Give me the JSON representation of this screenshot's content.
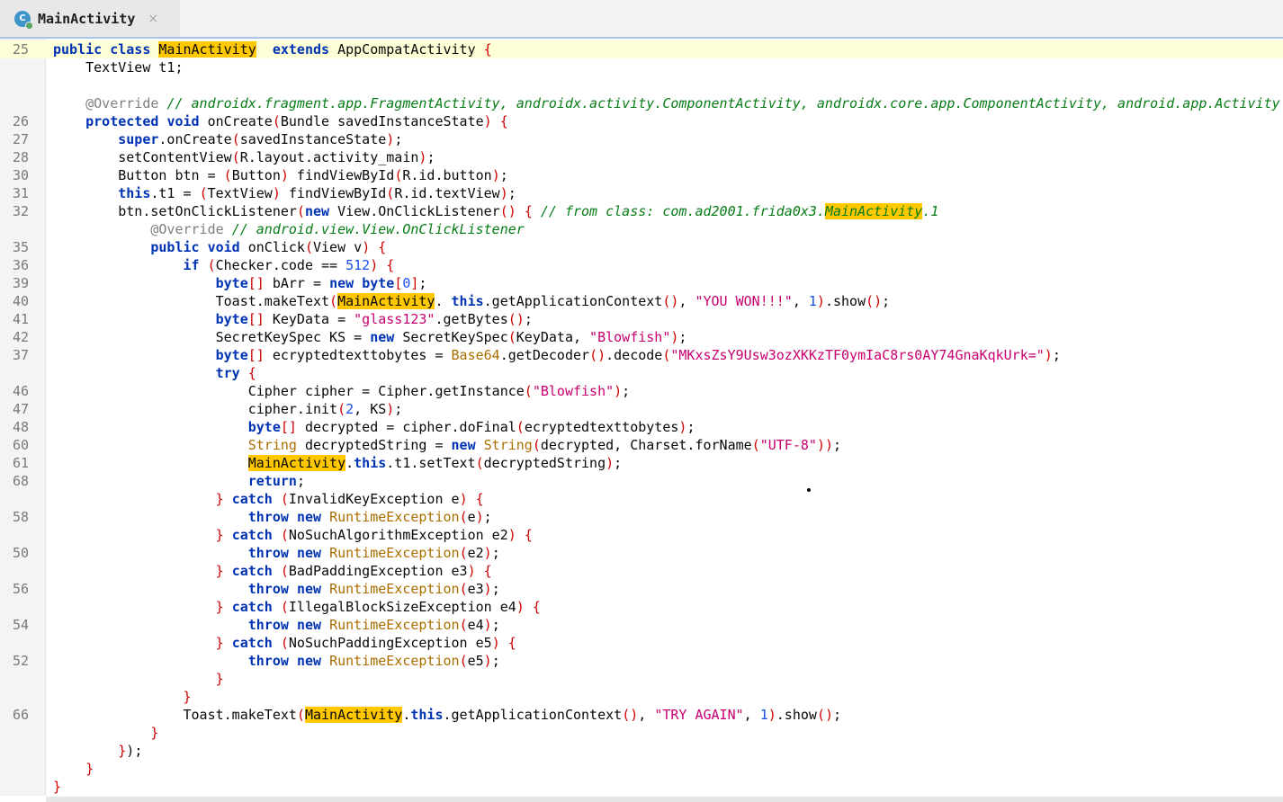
{
  "tab": {
    "title": "MainActivity",
    "icon": "class-icon",
    "icon_letter": "C",
    "close_glyph": "×"
  },
  "code_lines": [
    {
      "ln": "25",
      "hl": true,
      "segs": [
        [
          "k",
          "public "
        ],
        [
          "k",
          "class "
        ],
        [
          "h",
          "MainActivity"
        ],
        [
          "",
          "  "
        ],
        [
          "k",
          "extends "
        ],
        [
          "",
          "AppCompatActivity "
        ],
        [
          "b",
          "{"
        ]
      ]
    },
    {
      "ln": "",
      "segs": [
        [
          "",
          "    TextView t1;"
        ]
      ]
    },
    {
      "ln": "",
      "segs": []
    },
    {
      "ln": "",
      "segs": [
        [
          "",
          "    "
        ],
        [
          "a",
          "@Override "
        ],
        [
          "c",
          "// androidx.fragment.app.FragmentActivity, androidx.activity.ComponentActivity, androidx.core.app.ComponentActivity, android.app.Activity"
        ]
      ]
    },
    {
      "ln": "26",
      "segs": [
        [
          "",
          "    "
        ],
        [
          "k",
          "protected "
        ],
        [
          "k",
          "void "
        ],
        [
          "",
          "onCreate"
        ],
        [
          "b",
          "("
        ],
        [
          "",
          "Bundle savedInstanceState"
        ],
        [
          "b",
          ")"
        ],
        [
          "",
          " "
        ],
        [
          "b",
          "{"
        ]
      ]
    },
    {
      "ln": "27",
      "segs": [
        [
          "",
          "        "
        ],
        [
          "k",
          "super"
        ],
        [
          "",
          ".onCreate"
        ],
        [
          "b",
          "("
        ],
        [
          "",
          "savedInstanceState"
        ],
        [
          "b",
          ")"
        ],
        [
          "",
          ";"
        ]
      ]
    },
    {
      "ln": "28",
      "segs": [
        [
          "",
          "        setContentView"
        ],
        [
          "b",
          "("
        ],
        [
          "",
          "R.layout.activity_main"
        ],
        [
          "b",
          ")"
        ],
        [
          "",
          ";"
        ]
      ]
    },
    {
      "ln": "30",
      "segs": [
        [
          "",
          "        Button btn = "
        ],
        [
          "b",
          "("
        ],
        [
          "",
          "Button"
        ],
        [
          "b",
          ")"
        ],
        [
          "",
          " findViewById"
        ],
        [
          "b",
          "("
        ],
        [
          "",
          "R.id.button"
        ],
        [
          "b",
          ")"
        ],
        [
          "",
          ";"
        ]
      ]
    },
    {
      "ln": "31",
      "segs": [
        [
          "",
          "        "
        ],
        [
          "k",
          "this"
        ],
        [
          "",
          ".t1 = "
        ],
        [
          "b",
          "("
        ],
        [
          "",
          "TextView"
        ],
        [
          "b",
          ")"
        ],
        [
          "",
          " findViewById"
        ],
        [
          "b",
          "("
        ],
        [
          "",
          "R.id.textView"
        ],
        [
          "b",
          ")"
        ],
        [
          "",
          ";"
        ]
      ]
    },
    {
      "ln": "32",
      "segs": [
        [
          "",
          "        btn.setOnClickListener"
        ],
        [
          "b",
          "("
        ],
        [
          "k",
          "new "
        ],
        [
          "",
          "View.OnClickListener"
        ],
        [
          "b",
          "()"
        ],
        [
          "",
          " "
        ],
        [
          "b",
          "{"
        ],
        [
          "",
          " "
        ],
        [
          "c",
          "// from class: com.ad2001.frida0x3."
        ],
        [
          "ch",
          "MainActivity"
        ],
        [
          "c",
          ".1"
        ]
      ]
    },
    {
      "ln": "",
      "segs": [
        [
          "",
          "            "
        ],
        [
          "a",
          "@Override "
        ],
        [
          "c",
          "// android.view.View.OnClickListener"
        ]
      ]
    },
    {
      "ln": "35",
      "segs": [
        [
          "",
          "            "
        ],
        [
          "k",
          "public "
        ],
        [
          "k",
          "void "
        ],
        [
          "",
          "onClick"
        ],
        [
          "b",
          "("
        ],
        [
          "",
          "View v"
        ],
        [
          "b",
          ")"
        ],
        [
          "",
          " "
        ],
        [
          "b",
          "{"
        ]
      ]
    },
    {
      "ln": "36",
      "segs": [
        [
          "",
          "                "
        ],
        [
          "k",
          "if "
        ],
        [
          "b",
          "("
        ],
        [
          "",
          "Checker.code == "
        ],
        [
          "n",
          "512"
        ],
        [
          "b",
          ")"
        ],
        [
          "",
          " "
        ],
        [
          "b",
          "{"
        ]
      ]
    },
    {
      "ln": "39",
      "segs": [
        [
          "",
          "                    "
        ],
        [
          "k",
          "byte"
        ],
        [
          "b",
          "[]"
        ],
        [
          "",
          " bArr = "
        ],
        [
          "k",
          "new "
        ],
        [
          "k",
          "byte"
        ],
        [
          "b",
          "["
        ],
        [
          "n",
          "0"
        ],
        [
          "b",
          "]"
        ],
        [
          "",
          ";"
        ]
      ]
    },
    {
      "ln": "40",
      "segs": [
        [
          "",
          "                    Toast.makeText"
        ],
        [
          "b",
          "("
        ],
        [
          "h",
          "MainActivity"
        ],
        [
          "",
          ". "
        ],
        [
          "k",
          "this"
        ],
        [
          "",
          ".getApplicationContext"
        ],
        [
          "b",
          "()"
        ],
        [
          "",
          ", "
        ],
        [
          "s",
          "\"YOU WON!!!\""
        ],
        [
          "",
          ", "
        ],
        [
          "n",
          "1"
        ],
        [
          "b",
          ")"
        ],
        [
          "",
          ".show"
        ],
        [
          "b",
          "()"
        ],
        [
          "",
          ";"
        ]
      ]
    },
    {
      "ln": "41",
      "segs": [
        [
          "",
          "                    "
        ],
        [
          "k",
          "byte"
        ],
        [
          "b",
          "[]"
        ],
        [
          "",
          " KeyData = "
        ],
        [
          "s",
          "\"glass123\""
        ],
        [
          "",
          ".getBytes"
        ],
        [
          "b",
          "()"
        ],
        [
          "",
          ";"
        ]
      ]
    },
    {
      "ln": "42",
      "segs": [
        [
          "",
          "                    SecretKeySpec KS = "
        ],
        [
          "k",
          "new "
        ],
        [
          "",
          "SecretKeySpec"
        ],
        [
          "b",
          "("
        ],
        [
          "",
          "KeyData, "
        ],
        [
          "s",
          "\"Blowfish\""
        ],
        [
          "b",
          ")"
        ],
        [
          "",
          ";"
        ]
      ]
    },
    {
      "ln": "37",
      "segs": [
        [
          "",
          "                    "
        ],
        [
          "k",
          "byte"
        ],
        [
          "b",
          "[]"
        ],
        [
          "",
          " ecryptedtexttobytes = "
        ],
        [
          "t",
          "Base64"
        ],
        [
          "",
          ".getDecoder"
        ],
        [
          "b",
          "()"
        ],
        [
          "",
          ".decode"
        ],
        [
          "b",
          "("
        ],
        [
          "s",
          "\"MKxsZsY9Usw3ozXKKzTF0ymIaC8rs0AY74GnaKqkUrk=\""
        ],
        [
          "b",
          ")"
        ],
        [
          "",
          ";"
        ]
      ]
    },
    {
      "ln": "",
      "segs": [
        [
          "",
          "                    "
        ],
        [
          "k",
          "try "
        ],
        [
          "b",
          "{"
        ]
      ]
    },
    {
      "ln": "46",
      "segs": [
        [
          "",
          "                        Cipher cipher = Cipher.getInstance"
        ],
        [
          "b",
          "("
        ],
        [
          "s",
          "\"Blowfish\""
        ],
        [
          "b",
          ")"
        ],
        [
          "",
          ";"
        ]
      ]
    },
    {
      "ln": "47",
      "segs": [
        [
          "",
          "                        cipher.init"
        ],
        [
          "b",
          "("
        ],
        [
          "n",
          "2"
        ],
        [
          "",
          ", KS"
        ],
        [
          "b",
          ")"
        ],
        [
          "",
          ";"
        ]
      ]
    },
    {
      "ln": "48",
      "segs": [
        [
          "",
          "                        "
        ],
        [
          "k",
          "byte"
        ],
        [
          "b",
          "[]"
        ],
        [
          "",
          " decrypted = cipher.doFinal"
        ],
        [
          "b",
          "("
        ],
        [
          "",
          "ecryptedtexttobytes"
        ],
        [
          "b",
          ")"
        ],
        [
          "",
          ";"
        ]
      ]
    },
    {
      "ln": "60",
      "segs": [
        [
          "",
          "                        "
        ],
        [
          "t",
          "String"
        ],
        [
          "",
          " decryptedString = "
        ],
        [
          "k",
          "new "
        ],
        [
          "t",
          "String"
        ],
        [
          "b",
          "("
        ],
        [
          "",
          "decrypted, Charset.forName"
        ],
        [
          "b",
          "("
        ],
        [
          "s",
          "\"UTF-8\""
        ],
        [
          "b",
          "))"
        ],
        [
          "",
          ";"
        ]
      ]
    },
    {
      "ln": "61",
      "segs": [
        [
          "",
          "                        "
        ],
        [
          "h",
          "MainActivity"
        ],
        [
          "",
          "."
        ],
        [
          "k",
          "this"
        ],
        [
          "",
          ".t1.setText"
        ],
        [
          "b",
          "("
        ],
        [
          "",
          "decryptedString"
        ],
        [
          "b",
          ")"
        ],
        [
          "",
          ";"
        ]
      ]
    },
    {
      "ln": "68",
      "segs": [
        [
          "",
          "                        "
        ],
        [
          "k",
          "return"
        ],
        [
          "",
          ";"
        ]
      ]
    },
    {
      "ln": "",
      "segs": [
        [
          "",
          "                    "
        ],
        [
          "b",
          "}"
        ],
        [
          "",
          " "
        ],
        [
          "k",
          "catch "
        ],
        [
          "b",
          "("
        ],
        [
          "",
          "InvalidKeyException e"
        ],
        [
          "b",
          ")"
        ],
        [
          "",
          " "
        ],
        [
          "b",
          "{"
        ]
      ]
    },
    {
      "ln": "58",
      "segs": [
        [
          "",
          "                        "
        ],
        [
          "k",
          "throw "
        ],
        [
          "k",
          "new "
        ],
        [
          "t",
          "RuntimeException"
        ],
        [
          "b",
          "("
        ],
        [
          "",
          "e"
        ],
        [
          "b",
          ")"
        ],
        [
          "",
          ";"
        ]
      ]
    },
    {
      "ln": "",
      "segs": [
        [
          "",
          "                    "
        ],
        [
          "b",
          "}"
        ],
        [
          "",
          " "
        ],
        [
          "k",
          "catch "
        ],
        [
          "b",
          "("
        ],
        [
          "",
          "NoSuchAlgorithmException e2"
        ],
        [
          "b",
          ")"
        ],
        [
          "",
          " "
        ],
        [
          "b",
          "{"
        ]
      ]
    },
    {
      "ln": "50",
      "segs": [
        [
          "",
          "                        "
        ],
        [
          "k",
          "throw "
        ],
        [
          "k",
          "new "
        ],
        [
          "t",
          "RuntimeException"
        ],
        [
          "b",
          "("
        ],
        [
          "",
          "e2"
        ],
        [
          "b",
          ")"
        ],
        [
          "",
          ";"
        ]
      ]
    },
    {
      "ln": "",
      "segs": [
        [
          "",
          "                    "
        ],
        [
          "b",
          "}"
        ],
        [
          "",
          " "
        ],
        [
          "k",
          "catch "
        ],
        [
          "b",
          "("
        ],
        [
          "",
          "BadPaddingException e3"
        ],
        [
          "b",
          ")"
        ],
        [
          "",
          " "
        ],
        [
          "b",
          "{"
        ]
      ]
    },
    {
      "ln": "56",
      "segs": [
        [
          "",
          "                        "
        ],
        [
          "k",
          "throw "
        ],
        [
          "k",
          "new "
        ],
        [
          "t",
          "RuntimeException"
        ],
        [
          "b",
          "("
        ],
        [
          "",
          "e3"
        ],
        [
          "b",
          ")"
        ],
        [
          "",
          ";"
        ]
      ]
    },
    {
      "ln": "",
      "segs": [
        [
          "",
          "                    "
        ],
        [
          "b",
          "}"
        ],
        [
          "",
          " "
        ],
        [
          "k",
          "catch "
        ],
        [
          "b",
          "("
        ],
        [
          "",
          "IllegalBlockSizeException e4"
        ],
        [
          "b",
          ")"
        ],
        [
          "",
          " "
        ],
        [
          "b",
          "{"
        ]
      ]
    },
    {
      "ln": "54",
      "segs": [
        [
          "",
          "                        "
        ],
        [
          "k",
          "throw "
        ],
        [
          "k",
          "new "
        ],
        [
          "t",
          "RuntimeException"
        ],
        [
          "b",
          "("
        ],
        [
          "",
          "e4"
        ],
        [
          "b",
          ")"
        ],
        [
          "",
          ";"
        ]
      ]
    },
    {
      "ln": "",
      "segs": [
        [
          "",
          "                    "
        ],
        [
          "b",
          "}"
        ],
        [
          "",
          " "
        ],
        [
          "k",
          "catch "
        ],
        [
          "b",
          "("
        ],
        [
          "",
          "NoSuchPaddingException e5"
        ],
        [
          "b",
          ")"
        ],
        [
          "",
          " "
        ],
        [
          "b",
          "{"
        ]
      ]
    },
    {
      "ln": "52",
      "segs": [
        [
          "",
          "                        "
        ],
        [
          "k",
          "throw "
        ],
        [
          "k",
          "new "
        ],
        [
          "t",
          "RuntimeException"
        ],
        [
          "b",
          "("
        ],
        [
          "",
          "e5"
        ],
        [
          "b",
          ")"
        ],
        [
          "",
          ";"
        ]
      ]
    },
    {
      "ln": "",
      "segs": [
        [
          "",
          "                    "
        ],
        [
          "b",
          "}"
        ]
      ]
    },
    {
      "ln": "",
      "segs": [
        [
          "",
          "                "
        ],
        [
          "b",
          "}"
        ]
      ]
    },
    {
      "ln": "66",
      "segs": [
        [
          "",
          "                Toast.makeText"
        ],
        [
          "b",
          "("
        ],
        [
          "h",
          "MainActivity"
        ],
        [
          "",
          "."
        ],
        [
          "k",
          "this"
        ],
        [
          "",
          ".getApplicationContext"
        ],
        [
          "b",
          "()"
        ],
        [
          "",
          ", "
        ],
        [
          "s",
          "\"TRY AGAIN\""
        ],
        [
          "",
          ", "
        ],
        [
          "n",
          "1"
        ],
        [
          "b",
          ")"
        ],
        [
          "",
          ".show"
        ],
        [
          "b",
          "()"
        ],
        [
          "",
          ";"
        ]
      ]
    },
    {
      "ln": "",
      "segs": [
        [
          "",
          "            "
        ],
        [
          "b",
          "}"
        ]
      ]
    },
    {
      "ln": "",
      "segs": [
        [
          "",
          "        "
        ],
        [
          "b",
          "}"
        ],
        [
          "",
          ")"
        ],
        [
          "",
          ";"
        ]
      ]
    },
    {
      "ln": "",
      "segs": [
        [
          "",
          "    "
        ],
        [
          "b",
          "}"
        ]
      ]
    },
    {
      "ln": "",
      "segs": [
        [
          "b",
          "}"
        ]
      ]
    }
  ]
}
